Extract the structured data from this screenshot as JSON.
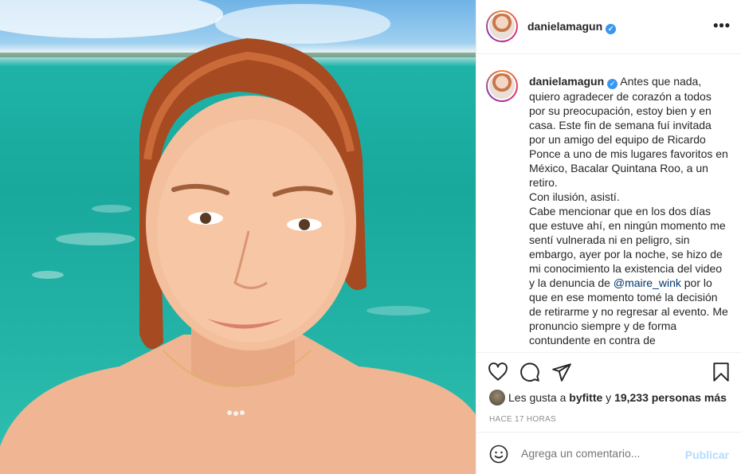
{
  "post": {
    "username": "danielamagun",
    "verified_mark": "✓"
  },
  "caption": {
    "username": "danielamagun",
    "paragraphs": [
      "Antes que nada, quiero agradecer de corazón a todos por su preocupación, estoy bien y en casa. Este fin de semana fuí invitada por un amigo del equipo de Ricardo Ponce a uno de mis lugares favoritos en México, Bacalar Quintana Roo, a un retiro.",
      "Con ilusión, asistí."
    ],
    "p3_before": "Cabe mencionar que en los dos días que estuve ahí, en ningún momento me sentí vulnerada ni en peligro, sin embargo, ayer por la noche, se hizo de mi conocimiento la existencia del video y la denuncia de",
    "mention": "@maire_wink",
    "p3_after": "por lo que en ese momento tomé la decisión de retirarme y no regresar al evento. Me pronuncio siempre y de forma contundente en contra de"
  },
  "likes": {
    "prefix": "Les gusta a",
    "user": "byfitte",
    "conjunction": "y",
    "count": "19,233 personas más"
  },
  "timestamp": "HACE 17 HORAS",
  "comment": {
    "placeholder": "Agrega un comentario...",
    "publish_label": "Publicar"
  },
  "icons": [
    "more-options-icon",
    "heart-icon",
    "comment-icon",
    "share-icon",
    "bookmark-icon",
    "emoji-icon",
    "verified-icon"
  ],
  "colors": {
    "verified": "#3897f0",
    "publish_disabled": "#b3dbff",
    "mention": "#00376b",
    "muted": "#8e8e8e"
  }
}
